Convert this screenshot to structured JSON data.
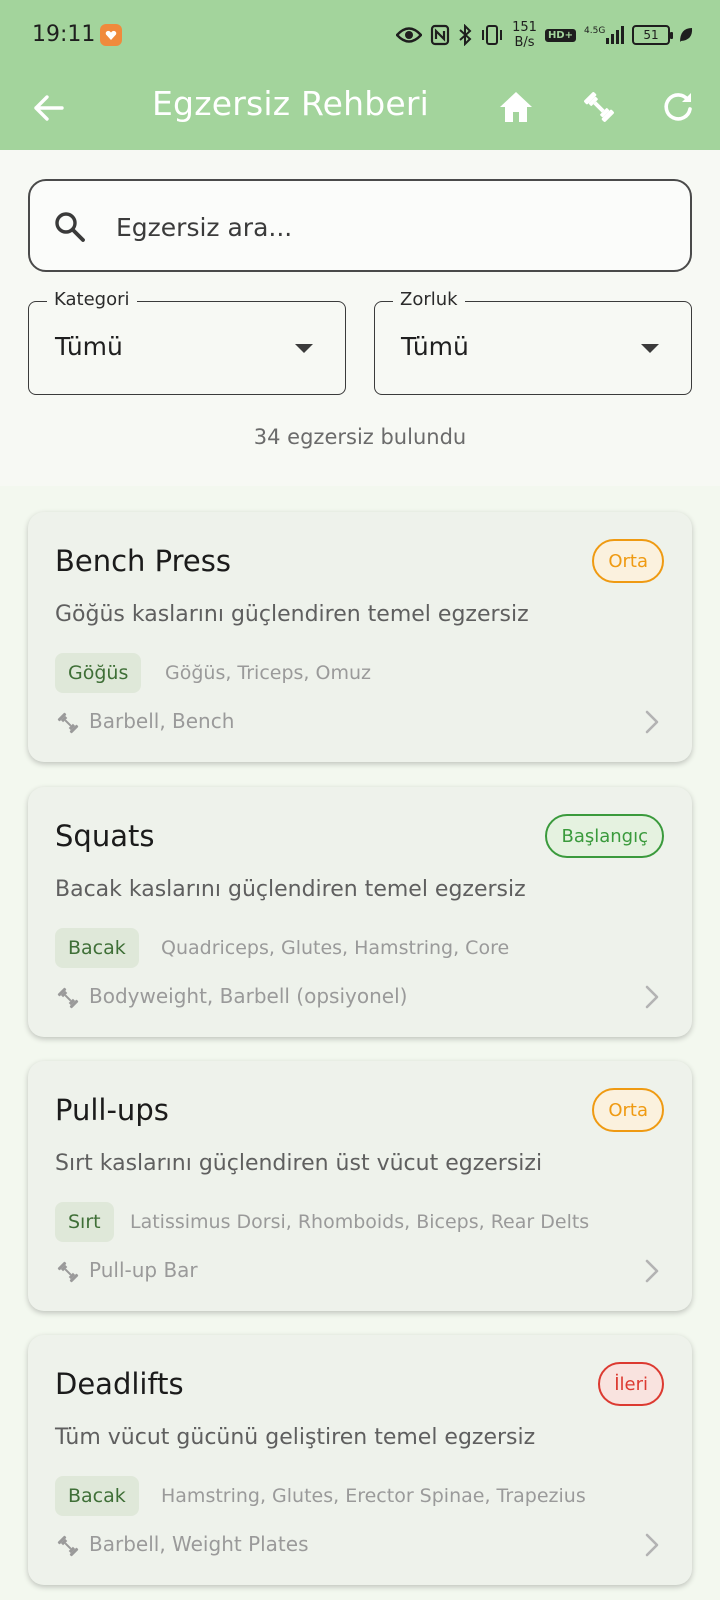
{
  "status_bar": {
    "time": "19:11",
    "net_speed_value": "151",
    "net_speed_unit": "B/s",
    "hd": "HD+",
    "network": "4.5G",
    "battery": "51"
  },
  "appbar": {
    "title": "Egzersiz Rehberi",
    "back_icon": "arrow-back-icon",
    "actions": [
      "home-icon",
      "fitness-icon",
      "refresh-icon"
    ]
  },
  "search": {
    "placeholder": "Egzersiz ara..."
  },
  "filters": {
    "category": {
      "label": "Kategori",
      "value": "Tümü"
    },
    "difficulty": {
      "label": "Zorluk",
      "value": "Tümü"
    }
  },
  "result_count": "34 egzersiz bulundu",
  "colors": {
    "appbar": "#a3d49c",
    "orta": "#ef9a12",
    "baslangic": "#3a9a3c",
    "ileri": "#dc3a31"
  },
  "exercises": [
    {
      "name": "Bench Press",
      "level": "Orta",
      "description": "Göğüs kaslarını güçlendiren temel egzersiz",
      "category": "Göğüs",
      "muscles": "Göğüs, Triceps, Omuz",
      "equipment": "Barbell, Bench"
    },
    {
      "name": "Squats",
      "level": "Başlangıç",
      "description": "Bacak kaslarını güçlendiren temel egzersiz",
      "category": "Bacak",
      "muscles": "Quadriceps, Glutes, Hamstring, Core",
      "equipment": "Bodyweight, Barbell (opsiyonel)"
    },
    {
      "name": "Pull-ups",
      "level": "Orta",
      "description": "Sırt kaslarını güçlendiren üst vücut egzersizi",
      "category": "Sırt",
      "muscles": "Latissimus Dorsi, Rhomboids, Biceps, Rear Delts",
      "equipment": "Pull-up Bar"
    },
    {
      "name": "Deadlifts",
      "level": "İleri",
      "description": "Tüm vücut gücünü geliştiren temel egzersiz",
      "category": "Bacak",
      "muscles": "Hamstring, Glutes, Erector Spinae, Trapezius",
      "equipment": "Barbell, Weight Plates"
    }
  ]
}
